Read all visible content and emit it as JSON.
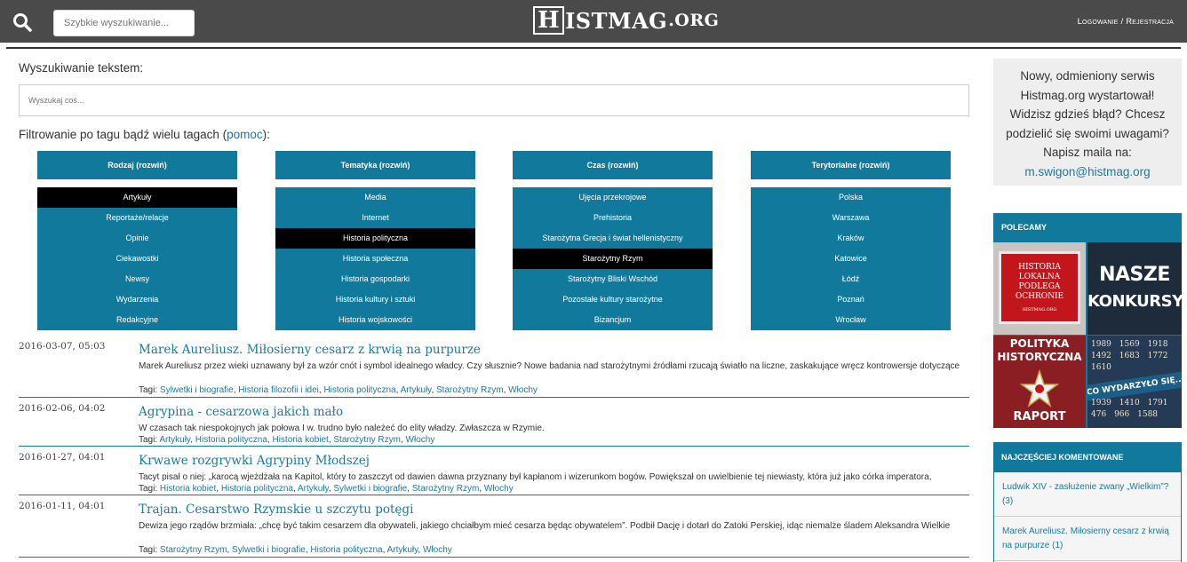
{
  "header": {
    "search_placeholder": "Szybkie wyszukiwanie...",
    "logo_first": "H",
    "logo_rest": "ISTMAG",
    "logo_suffix": ".ORG",
    "login": "Logowanie",
    "separator": " / ",
    "register": "Rejestracja"
  },
  "search": {
    "label": "Wyszukiwanie tekstem:",
    "placeholder": "Wyszukaj coś..."
  },
  "filter": {
    "label": "Filtrowanie po tagu bądź wielu tagach ",
    "paren_open": "(",
    "help": "pomoc",
    "paren_close": "):",
    "columns": [
      {
        "heading": "Rodzaj (rozwiń)",
        "items": [
          "Artykuły",
          "Reportaże/relacje",
          "Opinie",
          "Ciekawostki",
          "Newsy",
          "Wydarzenia",
          "Redakcyjne"
        ],
        "selected": 0
      },
      {
        "heading": "Tematyka (rozwiń)",
        "items": [
          "Media",
          "Internet",
          "Historia polityczna",
          "Historia społeczna",
          "Historia gospodarki",
          "Historia kultury i sztuki",
          "Historia wojskowości"
        ],
        "selected": 2
      },
      {
        "heading": "Czas (rozwiń)",
        "items": [
          "Ujęcia przekrojowe",
          "Prehistoria",
          "Starożytna Grecja i świat hellenistyczny",
          "Starożytny Rzym",
          "Starożytny Bliski Wschód",
          "Pozostałe kultury starożytne",
          "Bizancjum"
        ],
        "selected": 3
      },
      {
        "heading": "Terytorialne (rozwiń)",
        "items": [
          "Polska",
          "Warszawa",
          "Kraków",
          "Katowice",
          "Łódź",
          "Poznań",
          "Wrocław"
        ],
        "selected": -1
      }
    ]
  },
  "articles": [
    {
      "date": "2016-03-07, 05:03",
      "title": "Marek Aureliusz. Miłosierny cesarz z krwią na purpurze",
      "desc": "Marek Aureliusz przez wieki uznawany był za wzór cnót i symbol idealnego władcy. Czy słusznie? Nowe badania nad starożytnymi źródłami rzucają światło na liczne, zaskakujące wręcz kontrowersje dotyczące",
      "tags_label": "Tagi: ",
      "tags": [
        "Sylwetki i biografie",
        "Historia filozofii i idei",
        "Historia polityczna",
        "Artykuły",
        "Starożytny Rzym",
        "Włochy"
      ]
    },
    {
      "date": "2016-02-06, 04:02",
      "title": "Agrypina - cesarzowa jakich mało",
      "desc": "W czasach tak niespokojnych jak połowa I w. trudno było należeć do elity władzy. Zwłaszcza w Rzymie.",
      "tags_label": "Tagi: ",
      "tags": [
        "Artykuły",
        "Historia polityczna",
        "Historia kobiet",
        "Starożytny Rzym",
        "Włochy"
      ]
    },
    {
      "date": "2016-01-27, 04:01",
      "title": "Krwawe rozgrywki Agrypiny Młodszej",
      "desc": "Tacyt pisał o niej: „karocą wjeżdżała na Kapitol, który to zaszczyt od dawien dawna przyznany był kapłanom i wizerunkom bogów. Powiększał on uwielbienie tej niewiasty, która już jako córka imperatora,",
      "tags_label": "Tagi: ",
      "tags": [
        "Historia kobiet",
        "Historia polityczna",
        "Artykuły",
        "Sylwetki i biografie",
        "Starożytny Rzym",
        "Włochy"
      ]
    },
    {
      "date": "2016-01-11, 04:01",
      "title": "Trajan. Cesarstwo Rzymskie u szczytu potęgi",
      "desc": "Dewiza jego rządów brzmiała: „chcę być takim cesarzem dla obywateli, jakiego chciałbym mieć cesarza będąc obywatelem”. Podbił Dację i dotarł do Zatoki Perskiej, idąc niemalże śladem Aleksandra Wielkie",
      "tags_label": "Tagi: ",
      "tags": [
        "Starożytny Rzym",
        "Sylwetki i biografie",
        "Historia polityczna",
        "Artykuły",
        "Włochy"
      ]
    }
  ],
  "sidebar": {
    "note_lines": [
      "Nowy, odmieniony serwis",
      "Histmag.org wystartował!",
      "Widzisz gdzieś błąd? Chcesz",
      "podzielić się swoimi uwagami?",
      "Napisz maila na:"
    ],
    "email": "m.swigon@histmag.org",
    "recommended": "POLECAMY",
    "promos": {
      "p1_lines": [
        "HISTORIA",
        "LOKALNA",
        "PODLEGA",
        "OCHRONIE"
      ],
      "p1_small": "HISTMAG.ORG",
      "p2_lines": [
        "NASZE",
        "KONKURSY"
      ],
      "p3_lines": [
        "POLITYKA",
        "HISTORYCZNA"
      ],
      "p3_bottom": "RAPORT",
      "p4_numbers": [
        "1989",
        "1569",
        "1918",
        "1492",
        "1683",
        "1772",
        "1610",
        "1939",
        "1410",
        "1791",
        "476",
        "966",
        "1588"
      ],
      "p4_banner": "CO WYDARZYŁO SIĘ..."
    },
    "most_commented": "NAJCZĘŚCIEJ KOMENTOWANE",
    "comments": [
      "Ludwik XIV - zasłużenie zwany „Wielkim”? (3)",
      "Marek Aureliusz. Miłosierny cesarz z krwią na purpurze (1)"
    ]
  }
}
